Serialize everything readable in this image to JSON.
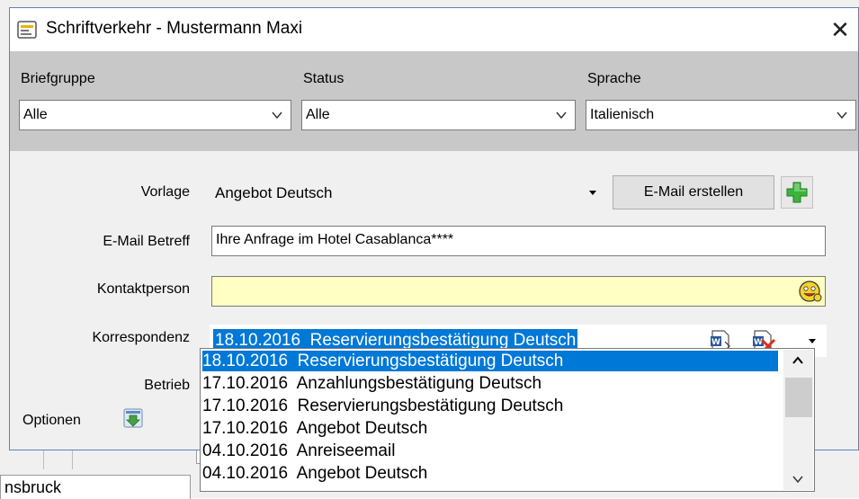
{
  "background": {
    "field_text": "nsbruck"
  },
  "window": {
    "title": "Schriftverkehr - Mustermann Maxi",
    "close_label": "✕"
  },
  "filters": {
    "briefgruppe": {
      "label": "Briefgruppe",
      "value": "Alle"
    },
    "status": {
      "label": "Status",
      "value": "Alle"
    },
    "sprache": {
      "label": "Sprache",
      "value": "Italienisch"
    }
  },
  "form": {
    "vorlage": {
      "label": "Vorlage",
      "value": "Angebot Deutsch"
    },
    "email_button": "E-Mail erstellen",
    "betreff": {
      "label": "E-Mail Betreff",
      "value": "Ihre Anfrage im Hotel Casablanca****"
    },
    "kontakt": {
      "label": "Kontaktperson",
      "value": ""
    },
    "korrespondenz": {
      "label": "Korrespondenz",
      "value": "18.10.2016  Reservierungsbestätigung Deutsch"
    },
    "betrieb_label": "Betrieb",
    "optionen_label": "Optionen"
  },
  "dropdown": {
    "items": [
      "18.10.2016  Reservierungsbestätigung Deutsch",
      "17.10.2016  Anzahlungsbestätigung Deutsch",
      "17.10.2016  Reservierungsbestätigung Deutsch",
      "17.10.2016  Angebot Deutsch",
      "04.10.2016  Anreiseemail",
      "04.10.2016  Angebot Deutsch"
    ],
    "selected_index": 0
  },
  "colors": {
    "accent": "#0078d7",
    "contact_bg": "#ffffc4",
    "filter_panel": "#c8c8c8"
  }
}
